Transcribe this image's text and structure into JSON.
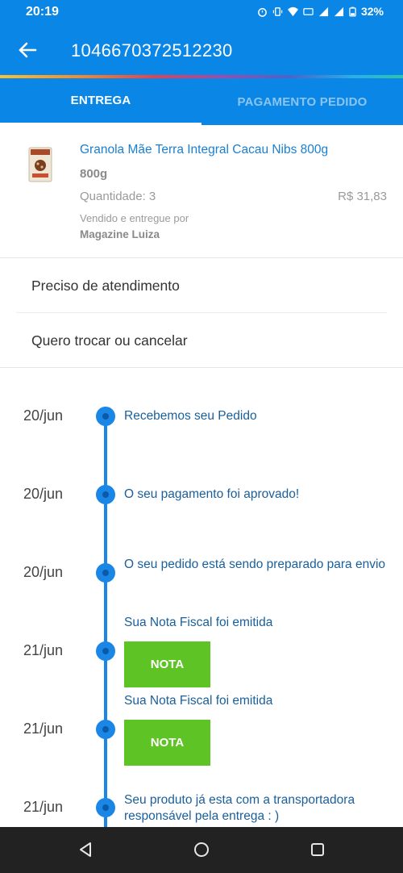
{
  "status_bar": {
    "time": "20:19",
    "battery": "32%",
    "icons": [
      "alarm-icon",
      "vibrate-icon",
      "wifi-icon",
      "volte-icon",
      "signal-icon",
      "battery-icon"
    ]
  },
  "app_bar": {
    "title": "1046670372512230",
    "back_icon": "arrow-left-icon"
  },
  "colors": {
    "primary": "#0a86e6",
    "link": "#1a7fd1",
    "timeline": "#1a86e6",
    "nota_button": "#5ec324",
    "navbar": "#222222"
  },
  "tabs": [
    {
      "label": "ENTREGA",
      "active": true
    },
    {
      "label": "PAGAMENTO PEDIDO",
      "active": false
    }
  ],
  "product": {
    "name": "Granola Mãe Terra Integral Cacau Nibs 800g",
    "weight": "800g",
    "quantity": "Quantidade: 3",
    "price": "R$ 31,83",
    "sold_by_label": "Vendido e entregue por",
    "seller": "Magazine Luiza"
  },
  "actions": [
    {
      "label": "Preciso de atendimento"
    },
    {
      "label": "Quero trocar ou cancelar"
    }
  ],
  "timeline": [
    {
      "date": "20/jun",
      "text": "Recebemos seu Pedido"
    },
    {
      "date": "20/jun",
      "text": "O seu pagamento foi aprovado!"
    },
    {
      "date": "20/jun",
      "text": "O seu pedido está sendo preparado para envio"
    },
    {
      "date": "21/jun",
      "text": "Sua Nota Fiscal foi emitida",
      "button": "NOTA"
    },
    {
      "date": "21/jun",
      "text": "Sua Nota Fiscal foi emitida",
      "button": "NOTA"
    },
    {
      "date": "21/jun",
      "text": "Seu produto já esta com a transportadora responsável pela entrega : )"
    }
  ],
  "nav_bar": {
    "icons": [
      "back-triangle-icon",
      "home-circle-icon",
      "recents-square-icon"
    ]
  }
}
